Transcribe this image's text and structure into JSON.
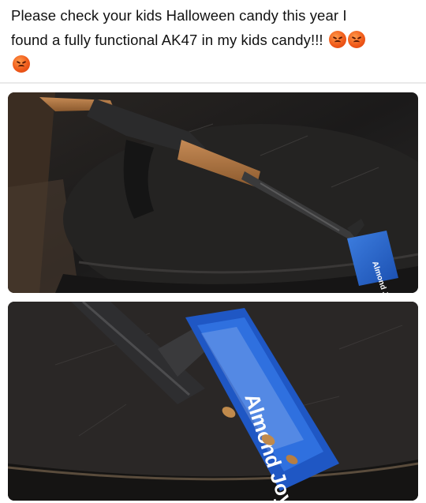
{
  "post": {
    "text_line1": "Please check your kids Halloween candy this year I",
    "text_line2": "found a fully functional AK47 in my kids candy!!!",
    "emoji_icon": "angry-face-icon",
    "emoji_color": "#f05a1a"
  },
  "photos": [
    {
      "icon": "rifle-on-table-photo",
      "candy_label": "Almond Joy"
    },
    {
      "icon": "candy-wrapper-closeup-photo",
      "candy_label": "Almond Joy"
    }
  ]
}
